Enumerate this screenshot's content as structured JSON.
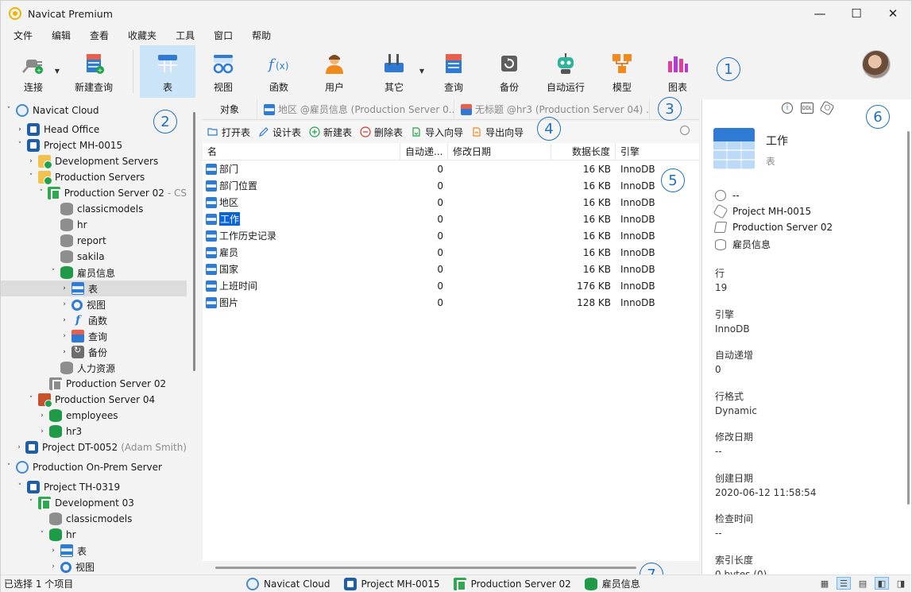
{
  "window": {
    "title": "Navicat Premium",
    "minimize": "—",
    "maximize": "☐",
    "close": "✕"
  },
  "menu": [
    "文件",
    "编辑",
    "查看",
    "收藏夹",
    "工具",
    "窗口",
    "帮助"
  ],
  "toolbar": {
    "connect": "连接",
    "new_query": "新建查询",
    "table": "表",
    "view": "视图",
    "function": "函数",
    "user": "用户",
    "other": "其它",
    "query": "查询",
    "backup": "备份",
    "automation": "自动运行",
    "model": "模型",
    "chart": "图表"
  },
  "callouts": [
    "1",
    "2",
    "3",
    "4",
    "5",
    "6",
    "7"
  ],
  "tree": [
    {
      "label": "Navicat Cloud",
      "twisty": "˅",
      "icon": "cloud"
    },
    {
      "label": "Head Office",
      "twisty": "›",
      "icon": "proj"
    },
    {
      "label": "Project MH-0015",
      "twisty": "˅",
      "icon": "proj"
    },
    {
      "label": "Development Servers",
      "twisty": "›",
      "icon": "folder"
    },
    {
      "label": "Production Servers",
      "twisty": "˅",
      "icon": "folder"
    },
    {
      "label": "Production Server 02",
      "sub": "- CS",
      "twisty": "˅",
      "icon": "server"
    },
    {
      "label": "classicmodels",
      "twisty": "",
      "icon": "db"
    },
    {
      "label": "hr",
      "twisty": "",
      "icon": "db"
    },
    {
      "label": "report",
      "twisty": "",
      "icon": "db"
    },
    {
      "label": "sakila",
      "twisty": "",
      "icon": "db"
    },
    {
      "label": "雇员信息",
      "twisty": "˅",
      "icon": "db-green"
    },
    {
      "label": "表",
      "twisty": "›",
      "icon": "table",
      "selected": true
    },
    {
      "label": "视图",
      "twisty": "›",
      "icon": "view"
    },
    {
      "label": "函数",
      "twisty": "›",
      "icon": "func"
    },
    {
      "label": "查询",
      "twisty": "›",
      "icon": "query"
    },
    {
      "label": "备份",
      "twisty": "›",
      "icon": "backup"
    },
    {
      "label": "人力资源",
      "twisty": "",
      "icon": "db"
    },
    {
      "label": "Production Server 02",
      "twisty": "",
      "icon": "server-gray"
    },
    {
      "label": "Production Server 04",
      "twisty": "˅",
      "icon": "server-red"
    },
    {
      "label": "employees",
      "twisty": "›",
      "icon": "db-green"
    },
    {
      "label": "hr3",
      "twisty": "›",
      "icon": "db-green"
    },
    {
      "label": "Project DT-0052",
      "sub": "(Adam Smith)",
      "twisty": "›",
      "icon": "proj"
    },
    {
      "label": "Production On-Prem Server",
      "twisty": "˅",
      "icon": "cloud"
    },
    {
      "label": "Project TH-0319",
      "twisty": "˅",
      "icon": "proj"
    },
    {
      "label": "Development 03",
      "twisty": "˅",
      "icon": "server"
    },
    {
      "label": "classicmodels",
      "twisty": "",
      "icon": "db"
    },
    {
      "label": "hr",
      "twisty": "˅",
      "icon": "db-green"
    },
    {
      "label": "表",
      "twisty": "›",
      "icon": "table"
    },
    {
      "label": "视图",
      "twisty": "›",
      "icon": "view"
    }
  ],
  "tabs": {
    "objects": "对象",
    "tab1": "地区 @雇员信息 (Production Server 0...",
    "tab2": "无标题 @hr3 (Production Server 04) ..."
  },
  "objbar": {
    "open": "打开表",
    "design": "设计表",
    "new": "新建表",
    "delete": "删除表",
    "import": "导入向导",
    "export": "导出向导"
  },
  "grid": {
    "columns": [
      "名",
      "自动递...",
      "修改日期",
      "数据长度",
      "引擎"
    ],
    "rows": [
      {
        "name": "部门",
        "inc": "0",
        "mod": "",
        "len": "16 KB",
        "eng": "InnoDB"
      },
      {
        "name": "部门位置",
        "inc": "0",
        "mod": "",
        "len": "16 KB",
        "eng": "InnoDB"
      },
      {
        "name": "地区",
        "inc": "0",
        "mod": "",
        "len": "16 KB",
        "eng": "InnoDB"
      },
      {
        "name": "工作",
        "inc": "0",
        "mod": "",
        "len": "16 KB",
        "eng": "InnoDB",
        "selected": true
      },
      {
        "name": "工作历史记录",
        "inc": "0",
        "mod": "",
        "len": "16 KB",
        "eng": "InnoDB"
      },
      {
        "name": "雇员",
        "inc": "0",
        "mod": "",
        "len": "16 KB",
        "eng": "InnoDB"
      },
      {
        "name": "国家",
        "inc": "0",
        "mod": "",
        "len": "16 KB",
        "eng": "InnoDB"
      },
      {
        "name": "上班时间",
        "inc": "0",
        "mod": "",
        "len": "176 KB",
        "eng": "InnoDB"
      },
      {
        "name": "图片",
        "inc": "0",
        "mod": "",
        "len": "128 KB",
        "eng": "InnoDB"
      }
    ]
  },
  "info": {
    "tab_info": "i",
    "tab_ddl": "DDL",
    "tab_deps": "⬡",
    "name": "工作",
    "type": "表",
    "meta": [
      "--",
      "Project MH-0015",
      "Production Server 02",
      "雇员信息"
    ],
    "fields": [
      {
        "label": "行",
        "value": "19"
      },
      {
        "label": "引擎",
        "value": "InnoDB"
      },
      {
        "label": "自动递增",
        "value": "0"
      },
      {
        "label": "行格式",
        "value": "Dynamic"
      },
      {
        "label": "修改日期",
        "value": "--"
      },
      {
        "label": "创建日期",
        "value": "2020-06-12 11:58:54"
      },
      {
        "label": "检查时间",
        "value": "--"
      },
      {
        "label": "索引长度",
        "value": "0 bytes (0)"
      }
    ]
  },
  "status": {
    "selection": "已选择 1 个项目",
    "cloud": "Navicat Cloud",
    "project": "Project MH-0015",
    "server": "Production Server 02",
    "database": "雇员信息"
  }
}
